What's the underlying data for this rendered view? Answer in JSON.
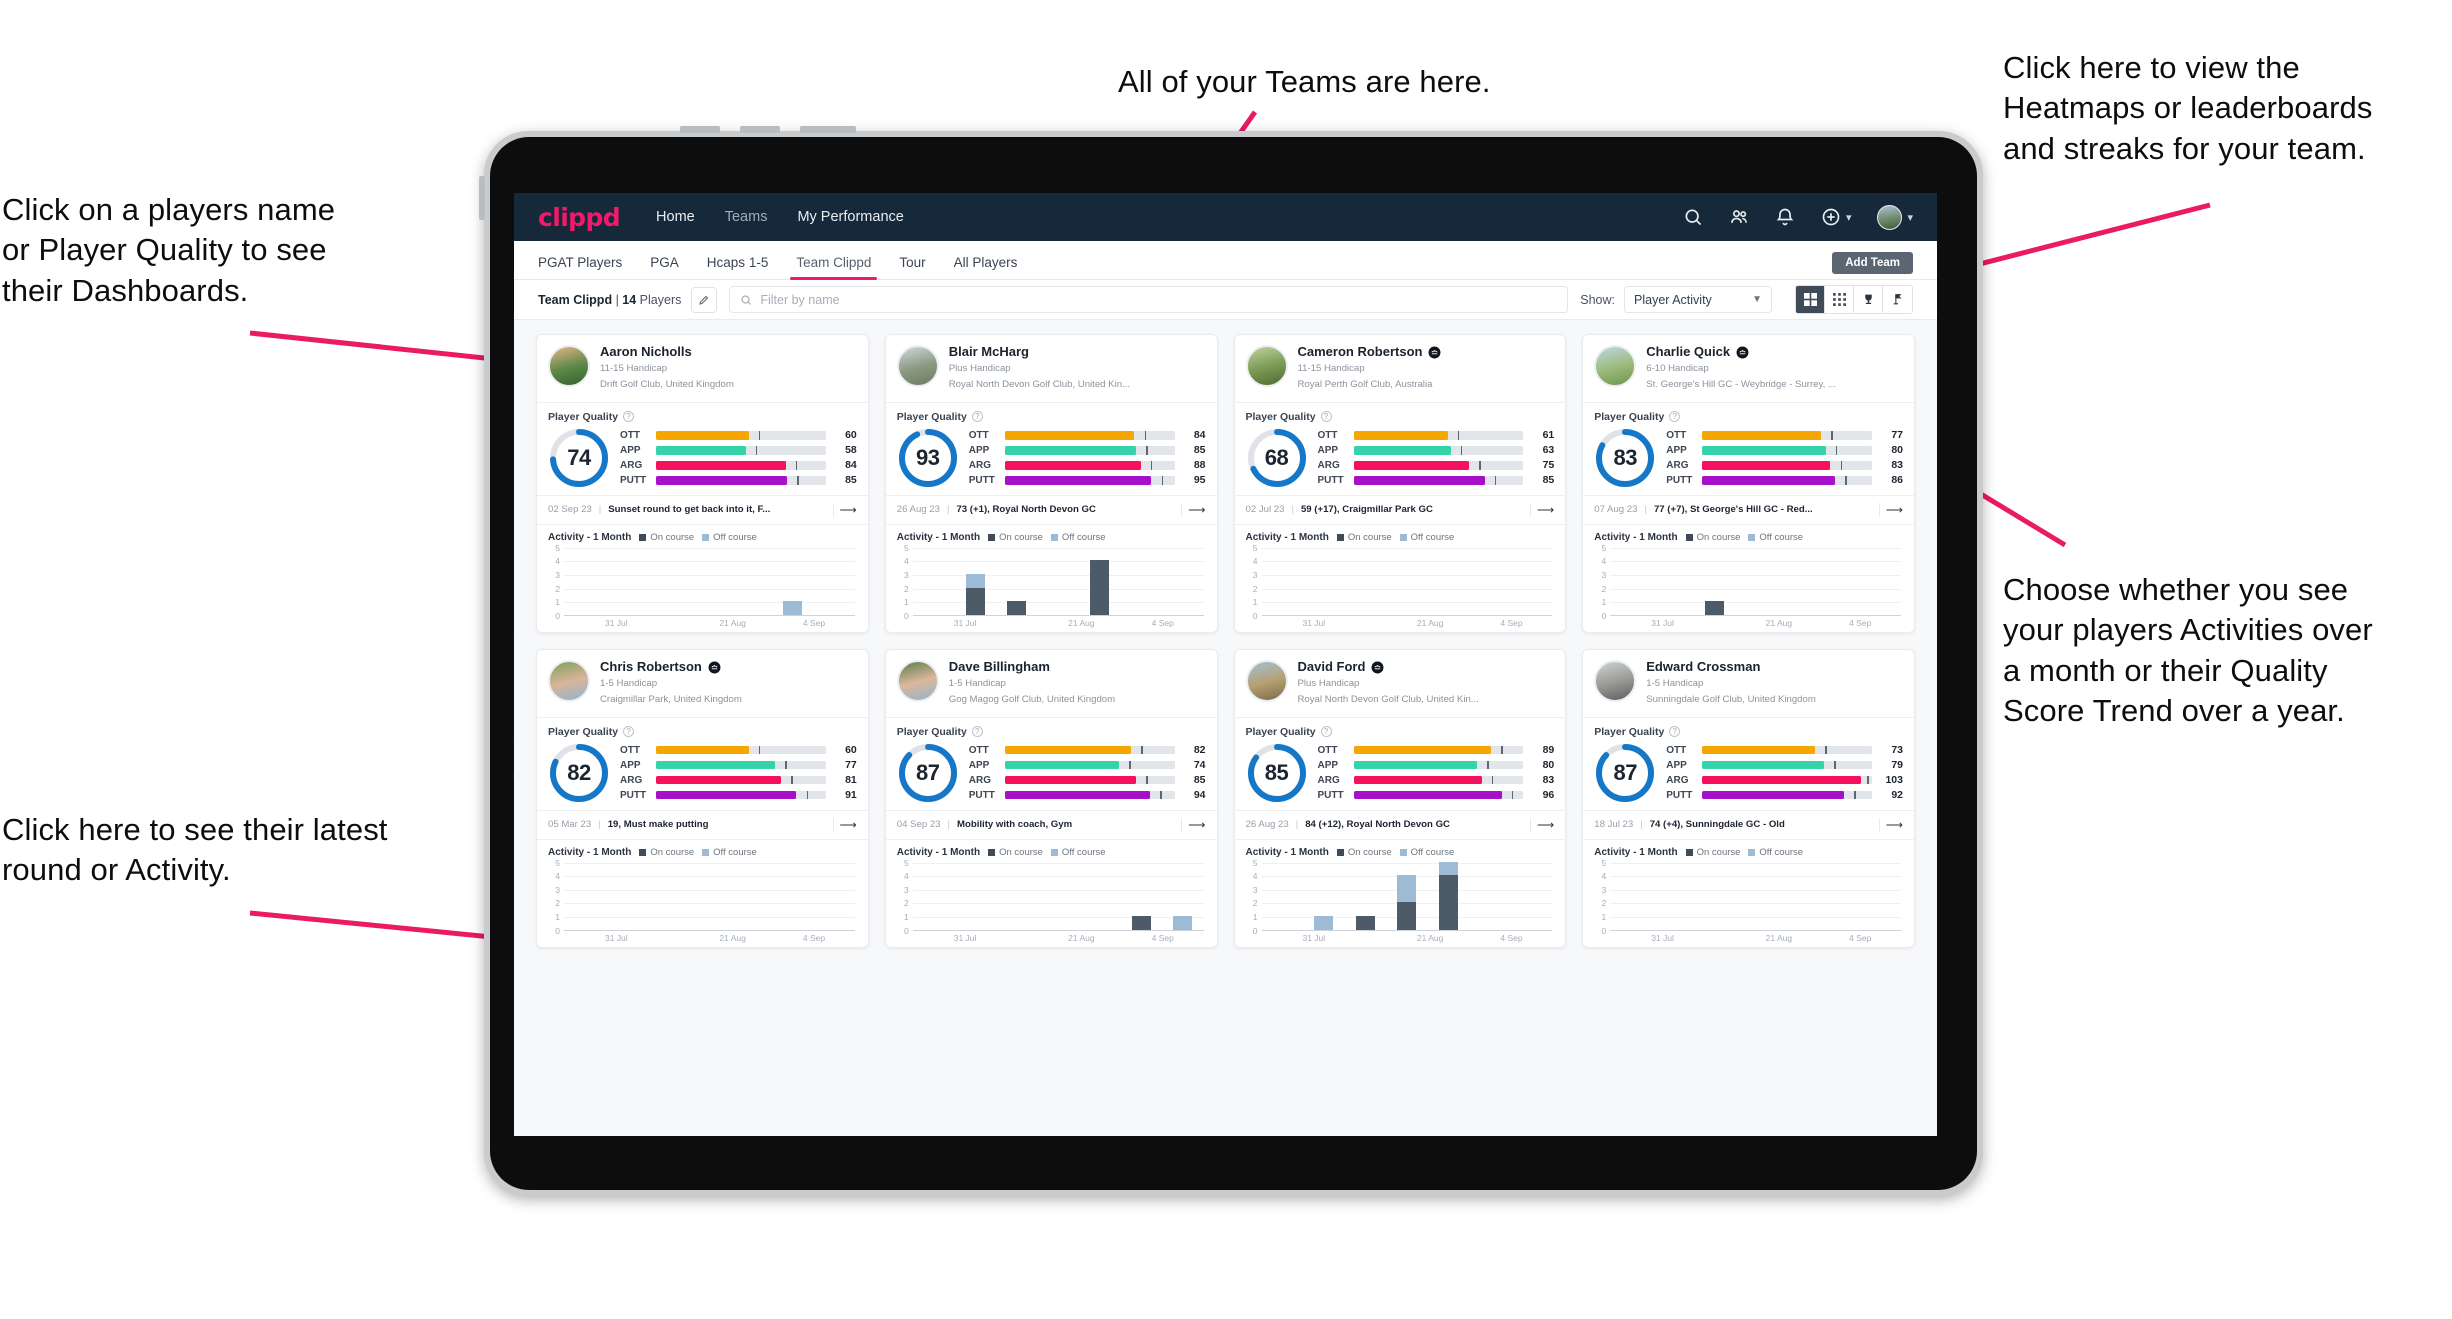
{
  "annotations": {
    "left_top": "Click on a players name\nor Player Quality to see\ntheir Dashboards.",
    "left_bottom": "Click here to see their latest\nround or Activity.",
    "top_center": "All of your Teams are here.",
    "right_top": "Click here to view the\nHeatmaps or leaderboards\nand streaks for your team.",
    "right_bottom": "Choose whether you see\nyour players Activities over\na month or their Quality\nScore Trend over a year.",
    "arrow_color": "#ea1a64"
  },
  "navbar": {
    "brand": "clippd",
    "links": [
      {
        "label": "Home",
        "active": true
      },
      {
        "label": "Teams",
        "active": false
      },
      {
        "label": "My Performance",
        "active": true
      }
    ],
    "icons": [
      "search-icon",
      "people-icon",
      "bell-icon",
      "plus-circle-icon",
      "avatar"
    ]
  },
  "tabs": {
    "items": [
      {
        "label": "PGAT Players",
        "active": false
      },
      {
        "label": "PGA",
        "active": false
      },
      {
        "label": "Hcaps 1-5",
        "active": false
      },
      {
        "label": "Team Clippd",
        "active": true
      },
      {
        "label": "Tour",
        "active": false
      },
      {
        "label": "All Players",
        "active": false
      }
    ],
    "add_team_label": "Add Team"
  },
  "filterbar": {
    "team_name": "Team Clippd",
    "team_separator": " | ",
    "player_count": "14",
    "players_word": " Players",
    "search_placeholder": "Filter by name",
    "show_label": "Show:",
    "show_value": "Player Activity",
    "view_modes": [
      "grid-large-icon",
      "grid-small-icon",
      "trophy-icon",
      "flag-icon"
    ],
    "active_view": 0
  },
  "chart_data": {
    "type": "bar",
    "title": "Activity - 1 Month",
    "categories": [
      "31 Jul",
      "21 Aug",
      "4 Sep"
    ],
    "xtick_positions": [
      0.18,
      0.58,
      0.86
    ],
    "ylim": [
      0,
      5
    ],
    "yticks": [
      0,
      1,
      2,
      3,
      4,
      5
    ],
    "legend": [
      "On course",
      "Off course"
    ],
    "legend_colors": [
      "#4d5a68",
      "#9dbbd4"
    ],
    "grid": true,
    "series_per_player": [
      {
        "player": "Aaron Nicholls",
        "bars": [
          {
            "slot": 5,
            "on": 0,
            "off": 1
          }
        ]
      },
      {
        "player": "Blair McHarg",
        "bars": [
          {
            "slot": 1,
            "on": 2,
            "off": 1
          },
          {
            "slot": 2,
            "on": 1,
            "off": 0
          },
          {
            "slot": 4,
            "on": 4,
            "off": 0
          }
        ]
      },
      {
        "player": "Cameron Robertson",
        "bars": []
      },
      {
        "player": "Charlie Quick",
        "bars": [
          {
            "slot": 2,
            "on": 1,
            "off": 0
          }
        ]
      },
      {
        "player": "Chris Robertson",
        "bars": []
      },
      {
        "player": "Dave Billingham",
        "bars": [
          {
            "slot": 5,
            "on": 1,
            "off": 0
          },
          {
            "slot": 6,
            "on": 0,
            "off": 1
          }
        ]
      },
      {
        "player": "David Ford",
        "bars": [
          {
            "slot": 1,
            "on": 0,
            "off": 1
          },
          {
            "slot": 2,
            "on": 1,
            "off": 0
          },
          {
            "slot": 3,
            "on": 2,
            "off": 2
          },
          {
            "slot": 4,
            "on": 4,
            "off": 1
          }
        ]
      },
      {
        "player": "Edward Crossman",
        "bars": []
      }
    ]
  },
  "cards_common": {
    "player_quality_label": "Player Quality",
    "activity_label": "Activity - 1 Month",
    "legend_on": "On course",
    "legend_off": "Off course",
    "metric_labels": [
      "OTT",
      "APP",
      "ARG",
      "PUTT"
    ],
    "metric_colors": [
      "#f5a600",
      "#34d3aa",
      "#f5115e",
      "#a510c8"
    ],
    "ring_color": "#1577c7",
    "ring_track": "#dfe3e8"
  },
  "players": [
    {
      "name": "Aaron Nicholls",
      "verified": false,
      "handicap": "11-15 Handicap",
      "club": "Drift Golf Club, United Kingdom",
      "quality": 74,
      "metrics": [
        60,
        58,
        84,
        85
      ],
      "latest_date": "02 Sep 23",
      "latest_text": "Sunset round to get back into it, F...",
      "avatar_colors": [
        "#e8b48a",
        "#5f8a49",
        "#35612f"
      ]
    },
    {
      "name": "Blair McHarg",
      "verified": false,
      "handicap": "Plus Handicap",
      "club": "Royal North Devon Golf Club, United Kin...",
      "quality": 93,
      "metrics": [
        84,
        85,
        88,
        95
      ],
      "latest_date": "26 Aug 23",
      "latest_text": "73 (+1), Royal North Devon GC",
      "avatar_colors": [
        "#cfd9dd",
        "#8c9a84",
        "#6b7c5d"
      ]
    },
    {
      "name": "Cameron Robertson",
      "verified": true,
      "handicap": "11-15 Handicap",
      "club": "Royal Perth Golf Club, Australia",
      "quality": 68,
      "metrics": [
        61,
        63,
        75,
        85
      ],
      "latest_date": "02 Jul 23",
      "latest_text": "59 (+17), Craigmillar Park GC",
      "avatar_colors": [
        "#bfd3a0",
        "#7d9a55",
        "#4e6b33"
      ]
    },
    {
      "name": "Charlie Quick",
      "verified": true,
      "handicap": "6-10 Handicap",
      "club": "St. George's Hill GC - Weybridge - Surrey, ...",
      "quality": 83,
      "metrics": [
        77,
        80,
        83,
        86
      ],
      "latest_date": "07 Aug 23",
      "latest_text": "77 (+7), St George's Hill GC - Red...",
      "avatar_colors": [
        "#bcd7e8",
        "#9dbb7c",
        "#6f9350"
      ]
    },
    {
      "name": "Chris Robertson",
      "verified": true,
      "handicap": "1-5 Handicap",
      "club": "Craigmillar Park, United Kingdom",
      "quality": 82,
      "metrics": [
        60,
        77,
        81,
        91
      ],
      "latest_date": "05 Mar 23",
      "latest_text": "19, Must make putting",
      "avatar_colors": [
        "#7fa05e",
        "#d9b49a",
        "#8fb4d0"
      ]
    },
    {
      "name": "Dave Billingham",
      "verified": false,
      "handicap": "1-5 Handicap",
      "club": "Gog Magog Golf Club, United Kingdom",
      "quality": 87,
      "metrics": [
        82,
        74,
        85,
        94
      ],
      "latest_date": "04 Sep 23",
      "latest_text": "Mobility with coach, Gym",
      "avatar_colors": [
        "#5d7d4a",
        "#dcb79c",
        "#8fb4d0"
      ]
    },
    {
      "name": "David Ford",
      "verified": true,
      "handicap": "Plus Handicap",
      "club": "Royal North Devon Golf Club, United Kin...",
      "quality": 85,
      "metrics": [
        89,
        80,
        83,
        96
      ],
      "latest_date": "26 Aug 23",
      "latest_text": "84 (+12), Royal North Devon GC",
      "avatar_colors": [
        "#9fc0d6",
        "#b6a173",
        "#7c6a45"
      ]
    },
    {
      "name": "Edward Crossman",
      "verified": false,
      "handicap": "1-5 Handicap",
      "club": "Sunningdale Golf Club, United Kingdom",
      "quality": 87,
      "metrics": [
        73,
        79,
        103,
        92
      ],
      "latest_date": "18 Jul 23",
      "latest_text": "74 (+4), Sunningdale GC - Old",
      "avatar_colors": [
        "#cfd4d8",
        "#9a9a96",
        "#5d5f5c"
      ]
    }
  ]
}
